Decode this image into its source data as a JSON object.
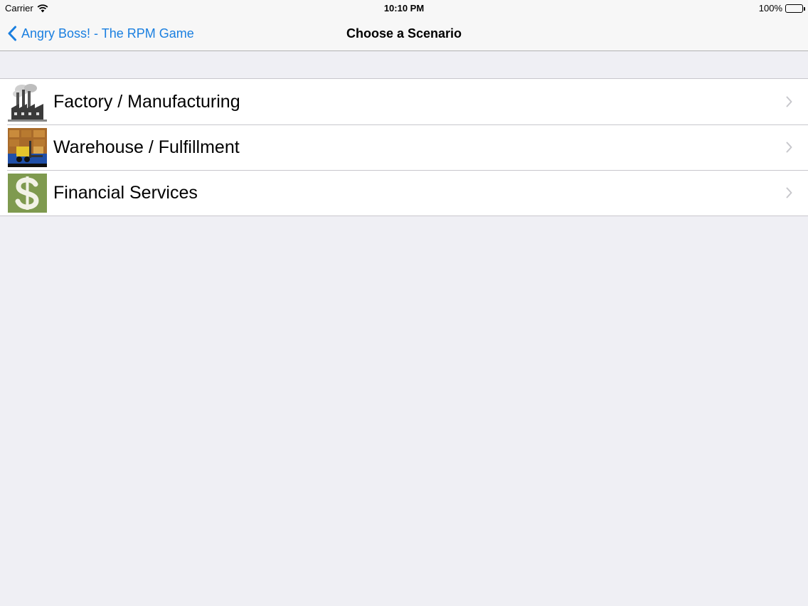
{
  "status_bar": {
    "carrier": "Carrier",
    "time": "10:10 PM",
    "battery": "100%"
  },
  "nav": {
    "back_label": "Angry Boss! - The RPM Game",
    "title": "Choose a Scenario",
    "accent_color": "#1a7fe0"
  },
  "scenarios": [
    {
      "label": "Factory / Manufacturing",
      "icon": "factory-icon"
    },
    {
      "label": "Warehouse / Fulfillment",
      "icon": "forklift-icon"
    },
    {
      "label": "Financial Services",
      "icon": "dollar-sign-icon"
    }
  ]
}
